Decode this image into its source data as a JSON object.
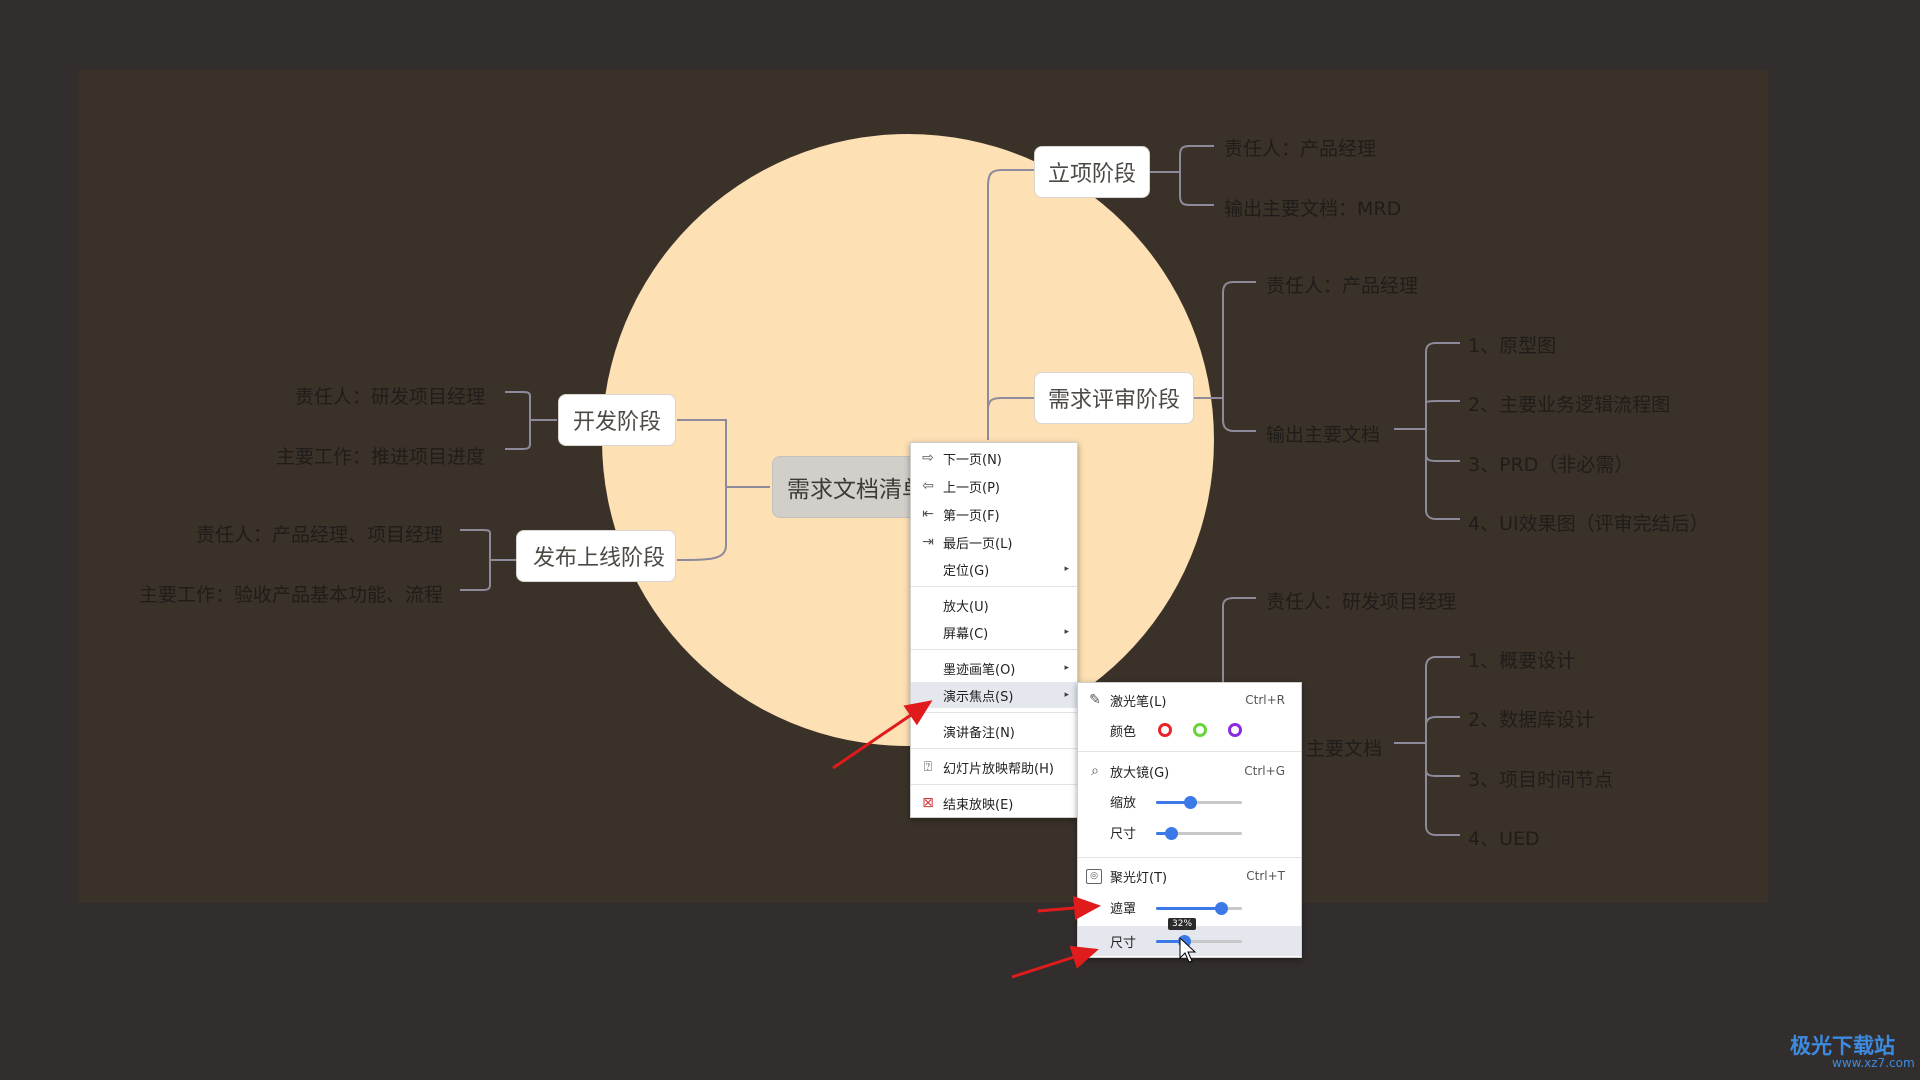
{
  "mindmap": {
    "root": "需求文档清单",
    "branch_lixiang": "立项阶段",
    "lixiang_owner": "责任人：产品经理",
    "lixiang_doc": "输出主要文档：MRD",
    "branch_pingshen": "需求评审阶段",
    "pingshen_owner": "责任人：产品经理",
    "pingshen_doc": "输出主要文档",
    "pingshen_items": [
      "1、原型图",
      "2、主要业务逻辑流程图",
      "3、PRD（非必需）",
      "4、UI效果图（评审完结后）"
    ],
    "dev_owner_right": "责任人：研发项目经理",
    "dev_doc_right": "主要文档",
    "dev_items": [
      "1、概要设计",
      "2、数据库设计",
      "3、项目时间节点",
      "4、UED"
    ],
    "branch_kaifa": "开发阶段",
    "kaifa_owner": "责任人：研发项目经理",
    "kaifa_work": "主要工作：推进项目进度",
    "branch_fabu": "发布上线阶段",
    "fabu_owner": "责任人：产品经理、项目经理",
    "fabu_work": "主要工作：验收产品基本功能、流程"
  },
  "context_menu": {
    "next": "下一页(N)",
    "prev": "上一页(P)",
    "first": "第一页(F)",
    "last": "最后一页(L)",
    "locate": "定位(G)",
    "zoom": "放大(U)",
    "screen": "屏幕(C)",
    "ink": "墨迹画笔(O)",
    "focus": "演示焦点(S)",
    "notes": "演讲备注(N)",
    "help": "幻灯片放映帮助(H)",
    "end": "结束放映(E)"
  },
  "focus_submenu": {
    "laser": "激光笔(L)",
    "laser_shortcut": "Ctrl+R",
    "color_label": "颜色",
    "colors": [
      "#e8232a",
      "#6ad33a",
      "#8a2be2"
    ],
    "magnifier": "放大镜(G)",
    "magnifier_shortcut": "Ctrl+G",
    "zoom_label": "缩放",
    "zoom_level": 0.4,
    "mag_size_label": "尺寸",
    "mag_size_level": 0.18,
    "spotlight": "聚光灯(T)",
    "spotlight_shortcut": "Ctrl+T",
    "mask_label": "遮罩",
    "mask_level": 0.76,
    "spot_size_label": "尺寸",
    "spot_size_level": 0.32,
    "spot_size_tooltip": "32%"
  },
  "watermark": {
    "name": "极光下载站",
    "url": "www.xz7.com"
  }
}
